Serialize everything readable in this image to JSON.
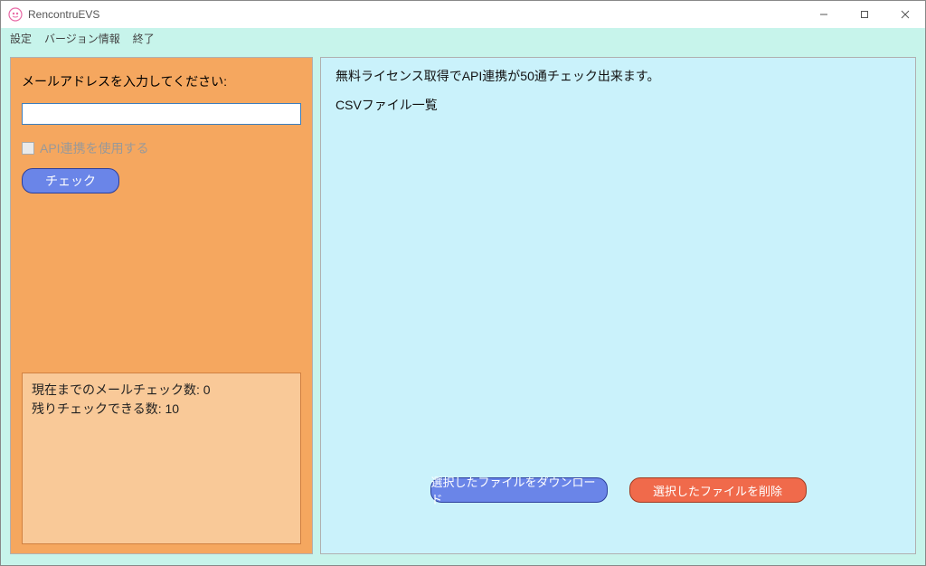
{
  "window": {
    "title": "RencontruEVS"
  },
  "menu": {
    "settings": "設定",
    "version": "バージョン情報",
    "exit": "終了"
  },
  "left": {
    "prompt": "メールアドレスを入力してください:",
    "email_value": "",
    "api_checkbox_label": "API連携を使用する",
    "check_button": "チェック",
    "stats_line1": "現在までのメールチェック数: 0",
    "stats_line2": "残りチェックできる数: 10"
  },
  "right": {
    "info": "無料ライセンス取得でAPI連携が50通チェック出来ます。",
    "csv_label": "CSVファイル一覧",
    "download_button": "選択したファイルをダウンロード",
    "delete_button": "選択したファイルを削除"
  }
}
